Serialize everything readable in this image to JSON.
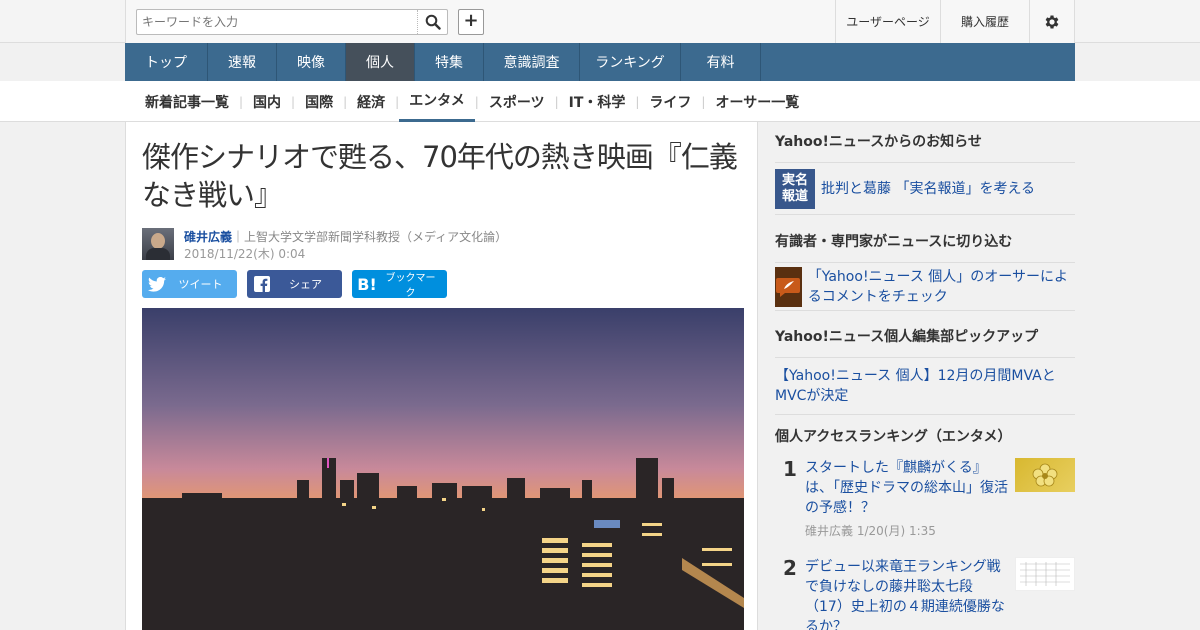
{
  "header": {
    "search_placeholder": "キーワードを入力",
    "user_page": "ユーザーページ",
    "purchase_history": "購入履歴"
  },
  "global_nav": [
    "トップ",
    "速報",
    "映像",
    "個人",
    "特集",
    "意識調査",
    "ランキング",
    "有料"
  ],
  "global_nav_active": "個人",
  "sub_nav": [
    "新着記事一覧",
    "国内",
    "国際",
    "経済",
    "エンタメ",
    "スポーツ",
    "IT・科学",
    "ライフ",
    "オーサー一覧"
  ],
  "sub_nav_active": "エンタメ",
  "article": {
    "title": "傑作シナリオで甦る、70年代の熱き映画『仁義なき戦い』",
    "author_name": "碓井広義",
    "author_desc": "｜上智大学文学部新聞学科教授（メディア文化論）",
    "date": "2018/11/22(木) 0:04",
    "share": {
      "tweet": "ツイート",
      "share": "シェア",
      "bookmark": "ブックマーク",
      "hatena_mark": "B!"
    }
  },
  "sidebar": {
    "notice_heading": "Yahoo!ニュースからのお知らせ",
    "notice_badge": "実名報道",
    "notice_link": "批判と葛藤 「実名報道」を考える",
    "experts_heading": "有識者・専門家がニュースに切り込む",
    "experts_link": "「Yahoo!ニュース 個人」のオーサーによるコメントをチェック",
    "pickup_heading": "Yahoo!ニュース個人編集部ピックアップ",
    "pickup_link": "【Yahoo!ニュース 個人】12月の月間MVAとMVCが決定",
    "ranking_heading": "個人アクセスランキング（エンタメ）",
    "ranking": [
      {
        "rank": "1",
        "title": "スタートした『麒麟がくる』は、「歴史ドラマの総本山」復活の予感！？",
        "meta": "碓井広義 1/20(月) 1:35"
      },
      {
        "rank": "2",
        "title": "デビュー以来竜王ランキング戦で負けなしの藤井聡太七段（17）史上初の４期連続優勝なるか？",
        "meta": ""
      }
    ]
  },
  "colors": {
    "nav_blue": "#3c6a8f",
    "link_blue": "#1a4fa0",
    "twitter": "#55acee",
    "facebook": "#3b5998",
    "hatena": "#008fde"
  }
}
